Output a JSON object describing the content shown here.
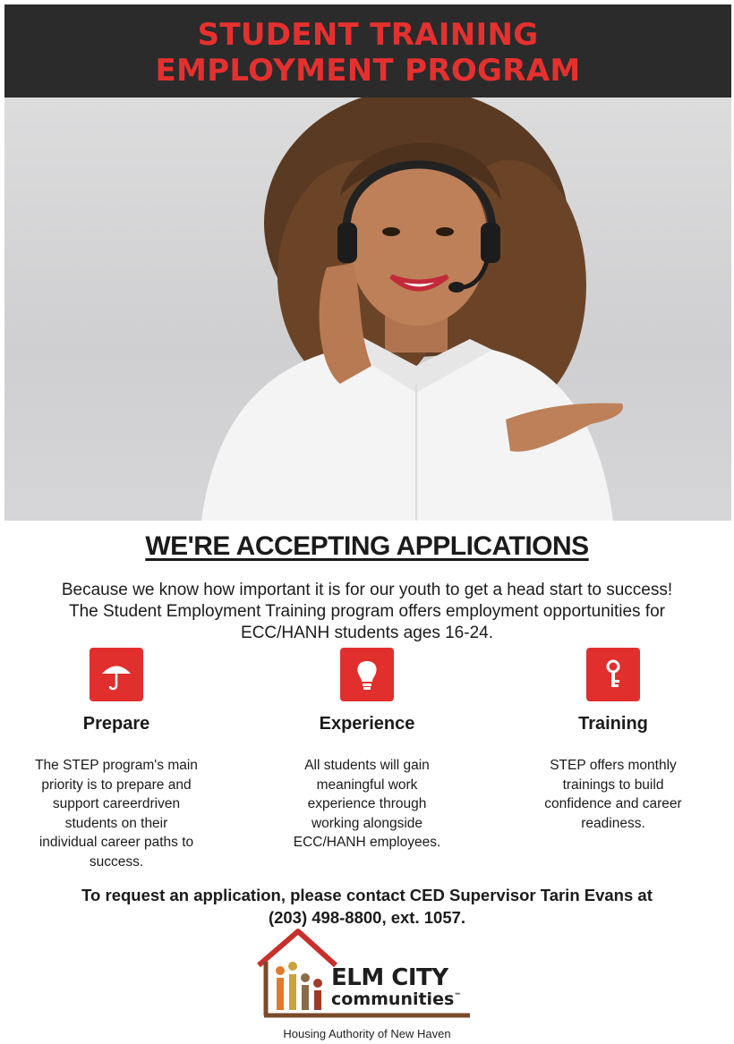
{
  "header": {
    "title_line1": "STUDENT TRAINING",
    "title_line2": "EMPLOYMENT PROGRAM"
  },
  "heading": "WE'RE ACCEPTING APPLICATIONS",
  "intro": {
    "line1": "Because we know how important it is for our youth to get a head start to success!",
    "line2": "The Student Employment Training program offers employment opportunities for",
    "line3": "ECC/HANH students ages 16-24."
  },
  "features": [
    {
      "icon": "umbrella-icon",
      "title": "Prepare",
      "lines": [
        "The STEP program's main",
        "priority is to prepare and",
        "support careerdriven",
        "students on their",
        "individual career paths to",
        "success."
      ]
    },
    {
      "icon": "lightbulb-icon",
      "title": "Experience",
      "lines": [
        "All students will gain",
        "meaningful work",
        "experience through",
        "working alongside",
        "ECC/HANH employees."
      ]
    },
    {
      "icon": "key-icon",
      "title": "Training",
      "lines": [
        "STEP offers monthly",
        "trainings to build",
        "confidence and career",
        "readiness."
      ]
    }
  ],
  "contact": {
    "line1": "To request an application, please contact CED Supervisor Tarin Evans at",
    "line2": "(203) 498-8800, ext. 1057."
  },
  "logo": {
    "name": "ELM CITY",
    "sub": "communities",
    "tm": "™",
    "tagline": "Housing Authority of New Haven"
  },
  "colors": {
    "accent_red": "#e12f2d",
    "header_bg": "#2b2b2c",
    "logo_brown": "#7a4a2a"
  }
}
